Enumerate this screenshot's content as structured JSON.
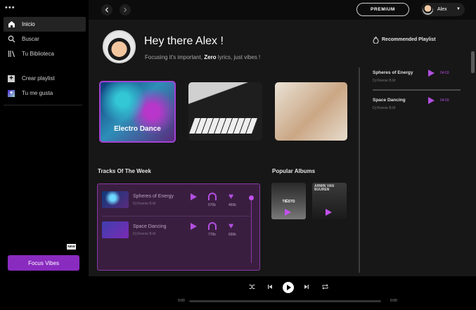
{
  "sidebar": {
    "menu_dots": "•••",
    "items": [
      {
        "label": "Inicio",
        "icon": "home-icon"
      },
      {
        "label": "Buscar",
        "icon": "search-icon"
      },
      {
        "label": "Tu Biblioteca",
        "icon": "library-icon"
      },
      {
        "label": "Crear playlist",
        "icon": "plus-square-icon"
      },
      {
        "label": "Tu me gusta",
        "icon": "liked-heart-icon"
      }
    ],
    "new_badge": "NEW",
    "focus_button": "Focus Vibes"
  },
  "topbar": {
    "premium_label": "PREMIUM",
    "user_name": "Alex"
  },
  "hero": {
    "greeting": "Hey there Alex !",
    "subtitle_before": "Focusing it's important, ",
    "subtitle_bold": "Zero",
    "subtitle_after": " lyrics, just vibes !"
  },
  "cards": [
    {
      "label": "Electro Dance"
    }
  ],
  "tracks_section": {
    "title": "Tracks Of The Week",
    "tracks": [
      {
        "name": "Spheres of Energy",
        "artist": "Dj Ronnie B.M",
        "listens": "570k",
        "likes": "460k"
      },
      {
        "name": "Space Dancing",
        "artist": "Dj Ronnie B.M",
        "listens": "770k",
        "likes": "690k"
      }
    ]
  },
  "albums_section": {
    "title": "Popular Albums",
    "albums": [
      {
        "cover_text": "TIËSTO"
      },
      {
        "cover_text": "ARMIN VAN BUUREN"
      }
    ]
  },
  "recommended": {
    "title": "Recommended Playlist",
    "items": [
      {
        "name": "Spheres of Energy",
        "artist": "Dj Ronnie B.M",
        "time": "04:03"
      },
      {
        "name": "Space Dancing",
        "artist": "Dj Ronnie B.M",
        "time": "04:03"
      }
    ]
  },
  "player": {
    "time_current": "0:00",
    "time_total": "0:00",
    "accent": "#b24fe0"
  }
}
